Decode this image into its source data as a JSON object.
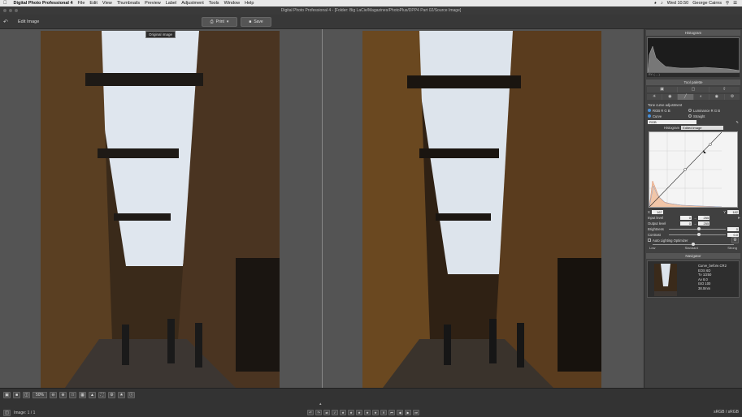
{
  "menubar": {
    "app": "Digital Photo Professional 4",
    "items": [
      "File",
      "Edit",
      "View",
      "Thumbnails",
      "Preview",
      "Label",
      "Adjustment",
      "Tools",
      "Window",
      "Help"
    ],
    "clock": "Wed 10.50",
    "user": "George Cairns"
  },
  "titlebar": {
    "title": "Digital Photo Professional 4 - [Folder: Big LaCie/Magazines/PhotoPlus/DPP4 Part 02/Source Image]"
  },
  "toolbar": {
    "mode": "Edit Image",
    "print": "Print",
    "save": "Save"
  },
  "stage": {
    "tooltip": "Original image"
  },
  "panel": {
    "histogram_title": "Histogram",
    "histogram_axis": "RY: ( , , )",
    "tool_palette_title": "Tool palette",
    "tone_curve_title": "Tone curve adjustment",
    "mode_rgb": "RGB R G B",
    "mode_luminance": "Luminance R G B",
    "curve": "Curve",
    "straight": "Straight",
    "channel": "RGB",
    "histogram_label": "Histogram",
    "histogram_select": "Edited image",
    "curve_x": "167",
    "curve_y": "182",
    "input_label": "Input level",
    "input_min": "0",
    "input_max": "255",
    "output_label": "Output level",
    "output_min": "0",
    "output_max": "255",
    "brightness_label": "Brightness",
    "brightness": "0",
    "contrast_label": "Contrast",
    "contrast": "0.0",
    "auto_lighting": "Auto Lighting Optimizer",
    "strength_low": "Low",
    "strength_std": "Standard",
    "strength_strong": "Strong",
    "navigator_title": "Navigator",
    "nav_info": [
      "Curve_before.CR2",
      "EOS 6D",
      "Tv 1/250",
      "Av 8.0",
      "ISO 100",
      "38.0mm"
    ]
  },
  "bottombar": {
    "zoom": "50%",
    "image_count": "Image: 1 / 1",
    "color_space": "sRGB / sRGB"
  },
  "colors": {
    "accent": "#4a90d9",
    "panel": "#404040",
    "stage": "#545454"
  }
}
